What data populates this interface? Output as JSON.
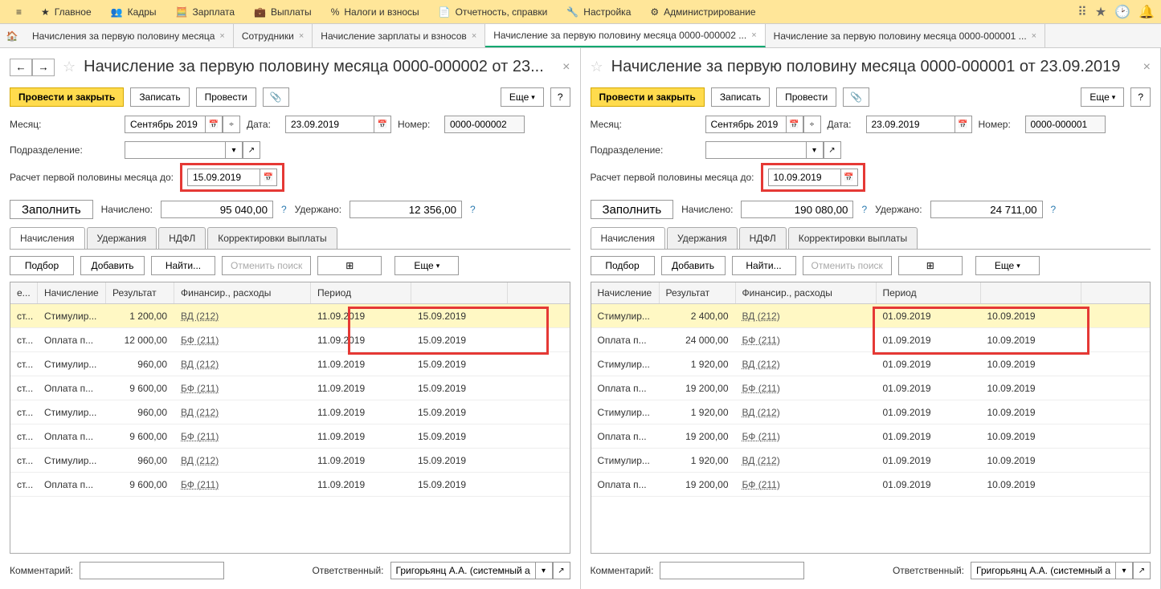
{
  "topmenu": {
    "items": [
      "Главное",
      "Кадры",
      "Зарплата",
      "Выплаты",
      "Налоги и взносы",
      "Отчетность, справки",
      "Настройка",
      "Администрирование"
    ]
  },
  "doctabs": [
    {
      "label": "Начисления за первую половину месяца"
    },
    {
      "label": "Сотрудники"
    },
    {
      "label": "Начисление зарплаты и взносов"
    },
    {
      "label": "Начисление за первую половину месяца 0000-000002 ...",
      "active": true
    },
    {
      "label": "Начисление за первую половину месяца 0000-000001 ..."
    }
  ],
  "left": {
    "title": "Начисление за первую половину месяца 0000-000002 от 23...",
    "toolbar": {
      "post_close": "Провести и закрыть",
      "write": "Записать",
      "post": "Провести",
      "more": "Еще"
    },
    "month_label": "Месяц:",
    "month": "Сентябрь 2019",
    "date_label": "Дата:",
    "date": "23.09.2019",
    "number_label": "Номер:",
    "number": "0000-000002",
    "dept_label": "Подразделение:",
    "calc_label": "Расчет первой половины месяца до:",
    "calc_date": "15.09.2019",
    "fill": "Заполнить",
    "accrued_label": "Начислено:",
    "accrued": "95 040,00",
    "withheld_label": "Удержано:",
    "withheld": "12 356,00",
    "subtabs": [
      "Начисления",
      "Удержания",
      "НДФЛ",
      "Корректировки выплаты"
    ],
    "tt": {
      "pick": "Подбор",
      "add": "Добавить",
      "find": "Найти...",
      "cancel_find": "Отменить поиск",
      "more": "Еще"
    },
    "cols": [
      "е...",
      "Начисление",
      "Результат",
      "Финансир., расходы",
      "Период",
      ""
    ],
    "rows": [
      {
        "a": "ст...",
        "b": "Стимулир...",
        "c": "1 200,00",
        "d": "ВД (212)",
        "e": "11.09.2019",
        "f": "15.09.2019",
        "sel": true
      },
      {
        "a": "ст...",
        "b": "Оплата п...",
        "c": "12 000,00",
        "d": "БФ (211)",
        "e": "11.09.2019",
        "f": "15.09.2019"
      },
      {
        "a": "ст...",
        "b": "Стимулир...",
        "c": "960,00",
        "d": "ВД (212)",
        "e": "11.09.2019",
        "f": "15.09.2019"
      },
      {
        "a": "ст...",
        "b": "Оплата п...",
        "c": "9 600,00",
        "d": "БФ (211)",
        "e": "11.09.2019",
        "f": "15.09.2019"
      },
      {
        "a": "ст...",
        "b": "Стимулир...",
        "c": "960,00",
        "d": "ВД (212)",
        "e": "11.09.2019",
        "f": "15.09.2019"
      },
      {
        "a": "ст...",
        "b": "Оплата п...",
        "c": "9 600,00",
        "d": "БФ (211)",
        "e": "11.09.2019",
        "f": "15.09.2019"
      },
      {
        "a": "ст...",
        "b": "Стимулир...",
        "c": "960,00",
        "d": "ВД (212)",
        "e": "11.09.2019",
        "f": "15.09.2019"
      },
      {
        "a": "ст...",
        "b": "Оплата п...",
        "c": "9 600,00",
        "d": "БФ (211)",
        "e": "11.09.2019",
        "f": "15.09.2019"
      }
    ],
    "comment_label": "Комментарий:",
    "resp_label": "Ответственный:",
    "resp": "Григорьянц А.А. (системный ад"
  },
  "right": {
    "title": "Начисление за первую половину месяца 0000-000001 от 23.09.2019",
    "toolbar": {
      "post_close": "Провести и закрыть",
      "write": "Записать",
      "post": "Провести",
      "more": "Еще"
    },
    "month_label": "Месяц:",
    "month": "Сентябрь 2019",
    "date_label": "Дата:",
    "date": "23.09.2019",
    "number_label": "Номер:",
    "number": "0000-000001",
    "dept_label": "Подразделение:",
    "calc_label": "Расчет первой половины месяца до:",
    "calc_date": "10.09.2019",
    "fill": "Заполнить",
    "accrued_label": "Начислено:",
    "accrued": "190 080,00",
    "withheld_label": "Удержано:",
    "withheld": "24 711,00",
    "subtabs": [
      "Начисления",
      "Удержания",
      "НДФЛ",
      "Корректировки выплаты"
    ],
    "tt": {
      "pick": "Подбор",
      "add": "Добавить",
      "find": "Найти...",
      "cancel_find": "Отменить поиск",
      "more": "Еще"
    },
    "cols": [
      "Начисление",
      "Результат",
      "Финансир., расходы",
      "Период",
      ""
    ],
    "rows": [
      {
        "b": "Стимулир...",
        "c": "2 400,00",
        "d": "ВД (212)",
        "e": "01.09.2019",
        "f": "10.09.2019",
        "sel": true
      },
      {
        "b": "Оплата п...",
        "c": "24 000,00",
        "d": "БФ (211)",
        "e": "01.09.2019",
        "f": "10.09.2019"
      },
      {
        "b": "Стимулир...",
        "c": "1 920,00",
        "d": "ВД (212)",
        "e": "01.09.2019",
        "f": "10.09.2019"
      },
      {
        "b": "Оплата п...",
        "c": "19 200,00",
        "d": "БФ (211)",
        "e": "01.09.2019",
        "f": "10.09.2019"
      },
      {
        "b": "Стимулир...",
        "c": "1 920,00",
        "d": "ВД (212)",
        "e": "01.09.2019",
        "f": "10.09.2019"
      },
      {
        "b": "Оплата п...",
        "c": "19 200,00",
        "d": "БФ (211)",
        "e": "01.09.2019",
        "f": "10.09.2019"
      },
      {
        "b": "Стимулир...",
        "c": "1 920,00",
        "d": "ВД (212)",
        "e": "01.09.2019",
        "f": "10.09.2019"
      },
      {
        "b": "Оплата п...",
        "c": "19 200,00",
        "d": "БФ (211)",
        "e": "01.09.2019",
        "f": "10.09.2019"
      }
    ],
    "comment_label": "Комментарий:",
    "resp_label": "Ответственный:",
    "resp": "Григорьянц А.А. (системный ад"
  }
}
